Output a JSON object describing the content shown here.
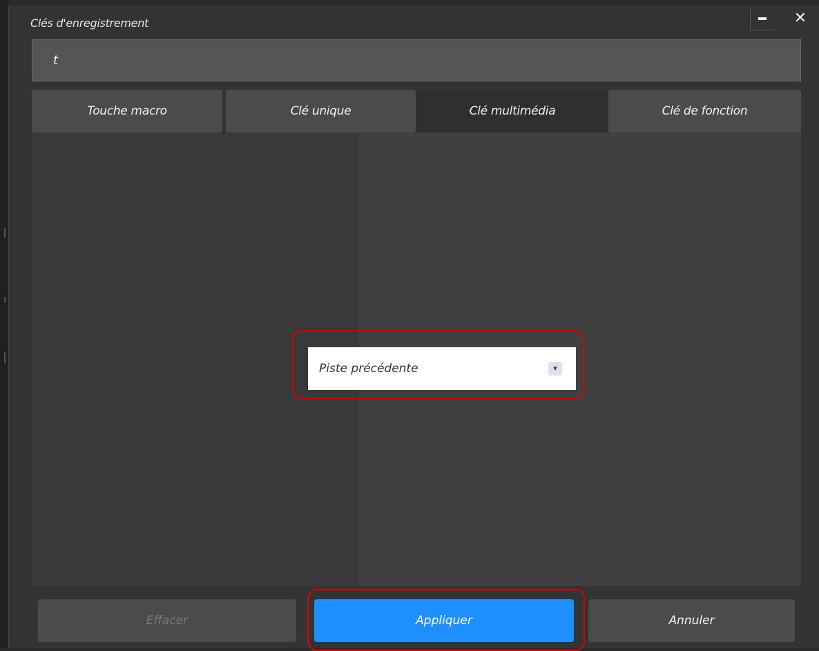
{
  "dialog": {
    "title": "Clés d'enregistrement",
    "minimize_icon": "minimize-icon",
    "close_icon": "close-icon"
  },
  "record_field": {
    "value": "t"
  },
  "tabs": [
    {
      "label": "Touche macro",
      "active": false
    },
    {
      "label": "Clé unique",
      "active": false
    },
    {
      "label": "Clé multimédia",
      "active": true
    },
    {
      "label": "Clé de fonction",
      "active": false
    }
  ],
  "multimedia": {
    "selected": "Piste précédente",
    "dropdown_icon": "chevron-down-icon"
  },
  "buttons": {
    "clear": "Effacer",
    "apply": "Appliquer",
    "cancel": "Annuler"
  },
  "colors": {
    "accent": "#1e8fff",
    "highlight": "#e00000",
    "background": "#333333"
  }
}
